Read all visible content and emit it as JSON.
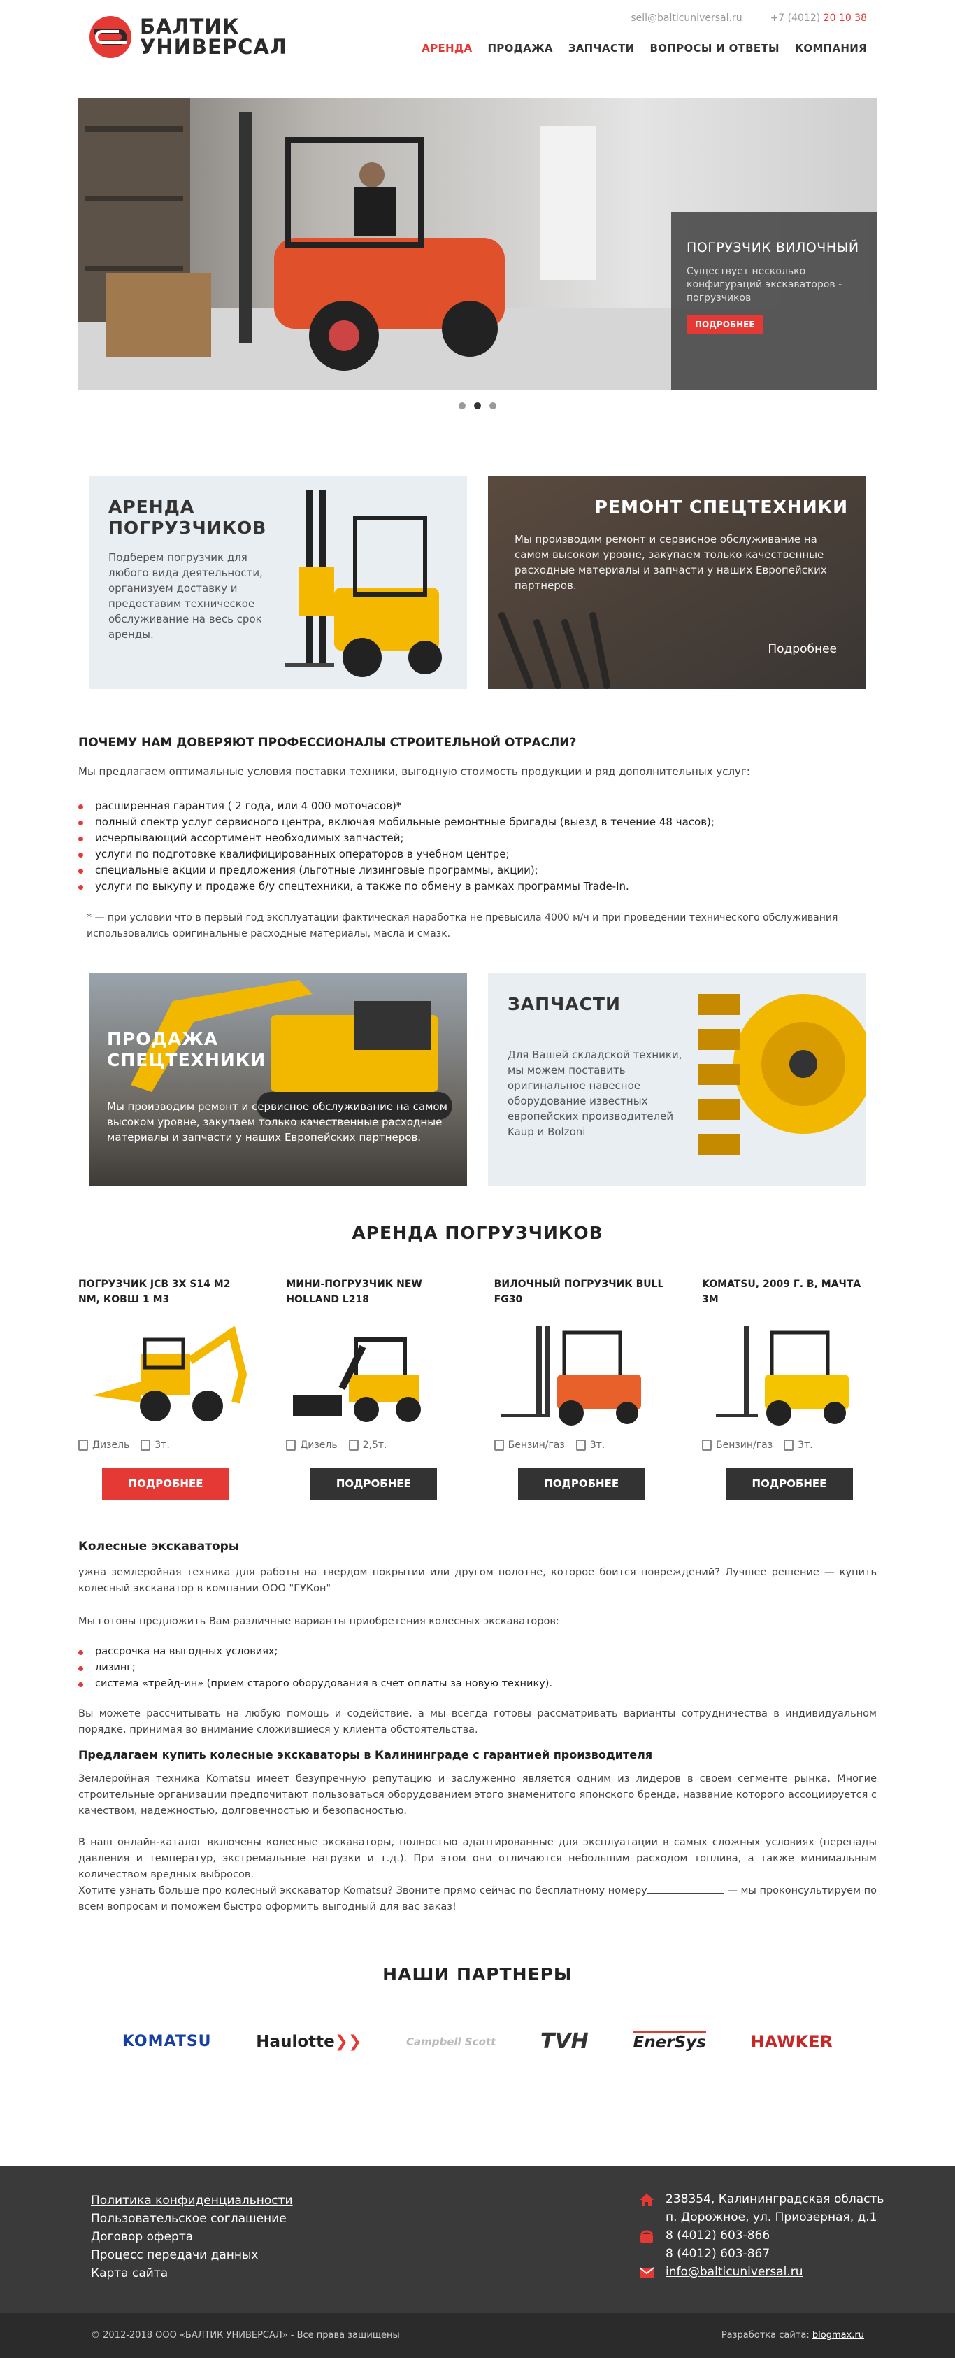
{
  "header": {
    "logo_line1": "БАЛТИК",
    "logo_line2": "УНИВЕРСАЛ",
    "email": "sell@balticuniversal.ru",
    "phone_prefix": "+7 (4012)",
    "phone_number": "20 10 38",
    "nav": [
      {
        "label": "АРЕНДА",
        "active": true
      },
      {
        "label": "ПРОДАЖА"
      },
      {
        "label": "ЗАПЧАСТИ"
      },
      {
        "label": "ВОПРОСЫ И ОТВЕТЫ"
      },
      {
        "label": "КОМПАНИЯ"
      }
    ]
  },
  "slider": {
    "title": "ПОГРУЗЧИК ВИЛОЧНЫЙ",
    "text": "Существует несколько конфигураций экскаваторов - погрузчиков",
    "button": "ПОДРОБНЕЕ",
    "active_slide": 2,
    "slide_count": 3
  },
  "tiles": {
    "rent": {
      "title": "АРЕНДА ПОГРУЗЧИКОВ",
      "text": "Подберем погрузчик для любого вида деятельности, организуем доставку и предоставим техническое обслуживание на весь срок аренды."
    },
    "repair": {
      "title": "РЕМОНТ СПЕЦТЕХНИКИ",
      "text": "Мы производим ремонт и сервисное обслуживание на самом высоком уровне, закупаем только качественные расходные материалы и запчасти у наших Европейских партнеров.",
      "more": "Подробнее"
    },
    "sale": {
      "title": "ПРОДАЖА СПЕЦТЕХНИКИ",
      "text": "Мы производим ремонт и сервисное обслуживание на самом высоком уровне, закупаем только качественные расходные материалы и запчасти у наших Европейских партнеров."
    },
    "parts": {
      "title": "ЗАПЧАСТИ",
      "text": "Для Вашей складской техники, мы можем поставить оригинальное навесное оборудование известных европейских производителей Kaup и Bolzoni"
    }
  },
  "trust": {
    "title": "ПОЧЕМУ НАМ ДОВЕРЯЮТ ПРОФЕССИОНАЛЫ СТРОИТЕЛЬНОЙ ОТРАСЛИ?",
    "intro": "Мы предлагаем оптимальные условия поставки техники, выгодную стоимость продукции и ряд дополнительных услуг:",
    "items": [
      "расширенная гарантия ( 2 года, или 4 000 моточасов)*",
      "полный спектр услуг сервисного центра, включая мобильные ремонтные бригады (выезд в течение 48 часов);",
      "исчерпывающий ассортимент необходимых запчастей;",
      "услуги по подготовке квалифицированных операторов в учебном центре;",
      "специальные акции и предложения (льготные лизинговые программы, акции);",
      "услуги по выкупу и продаже б/у спецтехники, а также по обмену в рамках программы Trade-In."
    ],
    "note": "* — при условии что в первый год эксплуатации фактическая наработка не превысила 4000 м/ч и при проведении технического обслуживания использовались оригинальные расходные материалы, масла и смазк."
  },
  "products_section": {
    "title": "АРЕНДА ПОГРУЗЧИКОВ",
    "items": [
      {
        "name": "ПОГРУЗЧИК JCB 3X S14 M2 NM, КОВШ 1 М3",
        "fuel": "Дизель",
        "weight": "3т.",
        "button": "ПОДРОБНЕЕ",
        "highlight": true
      },
      {
        "name": "МИНИ-ПОГРУЗЧИК NEW HOLLAND L218",
        "fuel": "Дизель",
        "weight": "2,5т.",
        "button": "ПОДРОБНЕЕ"
      },
      {
        "name": "ВИЛОЧНЫЙ ПОГРУЗЧИК BULL FG30",
        "fuel": "Бензин/газ",
        "weight": "3т.",
        "button": "ПОДРОБНЕЕ"
      },
      {
        "name": "KOMATSU, 2009 Г. В, МАЧТА 3М",
        "fuel": "Бензин/газ",
        "weight": "3т.",
        "button": "ПОДРОБНЕЕ"
      }
    ]
  },
  "article": {
    "h1": "Колесные экскаваторы",
    "p1": "ужна землеройная техника для работы на твердом покрытии или другом полотне, которое боится повреждений? Лучшее решение — купить колесный экскаватор в компании ООО \"ГУКон\"",
    "p2": "Мы готовы предложить Вам различные варианты приобретения колесных экскаваторов:",
    "items": [
      "рассрочка на выгодных условиях;",
      "лизинг;",
      "система «трейд-ин» (прием старого оборудования в счет оплаты за новую технику)."
    ],
    "p3": "Вы можете рассчитывать на любую помощь и содействие, а мы всегда готовы рассматривать варианты сотрудничества в индивидуальном порядке, принимая во внимание сложившиеся у клиента обстоятельства.",
    "h2": "Предлагаем купить колесные экскаваторы в  Калининграде с гарантией производителя",
    "p4": "Землеройная техника Komatsu имеет безупречную репутацию и заслуженно является одним из лидеров в своем сегменте рынка. Многие строительные организации предпочитают пользоваться оборудованием этого знаменитого японского бренда, название которого ассоциируется с качеством, надежностью, долговечностью и безопасностью.",
    "p5": "В наш онлайн-каталог включены колесные экскаваторы, полностью адаптированные для эксплуатации в самых сложных условиях (перепады давления и температур, экстремальные нагрузки и т.д.). При этом они отличаются небольшим расходом топлива, а также минимальным количеством вредных выбросов.",
    "p6a": "Хотите узнать больше про колесный экскаватор Komatsu? Звоните прямо сейчас по бесплатному номеру",
    "p6b": " — мы проконсультируем по всем вопросам и поможем быстро оформить выгодный для вас заказ!"
  },
  "partners": {
    "title": "НАШИ ПАРТНЕРЫ",
    "logos": [
      "KOMATSU",
      "Haulotte",
      "Campbell Scott",
      "TVH",
      "EnerSys",
      "HAWKER"
    ]
  },
  "footer": {
    "links": [
      "Политика конфиденциальности",
      "Пользовательское соглашение",
      "Договор оферта",
      "Процесс передачи данных",
      "Карта сайта"
    ],
    "address_line1": "238354, Калининградская область",
    "address_line2": "п. Дорожное, ул. Приозерная, д.1",
    "phone1": "8 (4012) 603-866",
    "phone2": "8 (4012) 603-867",
    "email": "info@balticuniversal.ru",
    "copyright": "© 2012-2018 ООО «БАЛТИК УНИВЕРСАЛ» - Все права защищены",
    "dev_label": "Разработка сайта:",
    "dev_link": "blogmax.ru"
  },
  "colors": {
    "accent": "#e53935",
    "dark": "#333333",
    "footer": "#3a3a3a",
    "tile_light": "#e9eef3"
  }
}
